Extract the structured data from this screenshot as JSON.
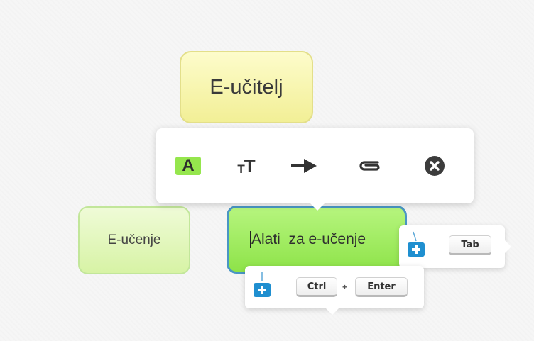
{
  "nodes": {
    "root": "E-učitelj",
    "left": "E-učenje",
    "selected": "Alati  za e-učenje"
  },
  "toolbar": {
    "text_color_glyph": "A",
    "text_size_small_glyph": "T",
    "text_size_big_glyph": "T",
    "icons": [
      "text-color-icon",
      "text-size-icon",
      "arrow-icon",
      "attachment-icon",
      "close-icon"
    ],
    "close_color": "#3c3c3c"
  },
  "hints": {
    "child": {
      "key": "Tab"
    },
    "sibling": {
      "key1": "Ctrl",
      "separator": "+",
      "key2": "Enter"
    }
  },
  "colors": {
    "root_fill": "#f7f4ad",
    "green_fill": "#9ee85a",
    "selected_border": "#4a96c4",
    "add_icon_blue": "#1f8fd0"
  }
}
